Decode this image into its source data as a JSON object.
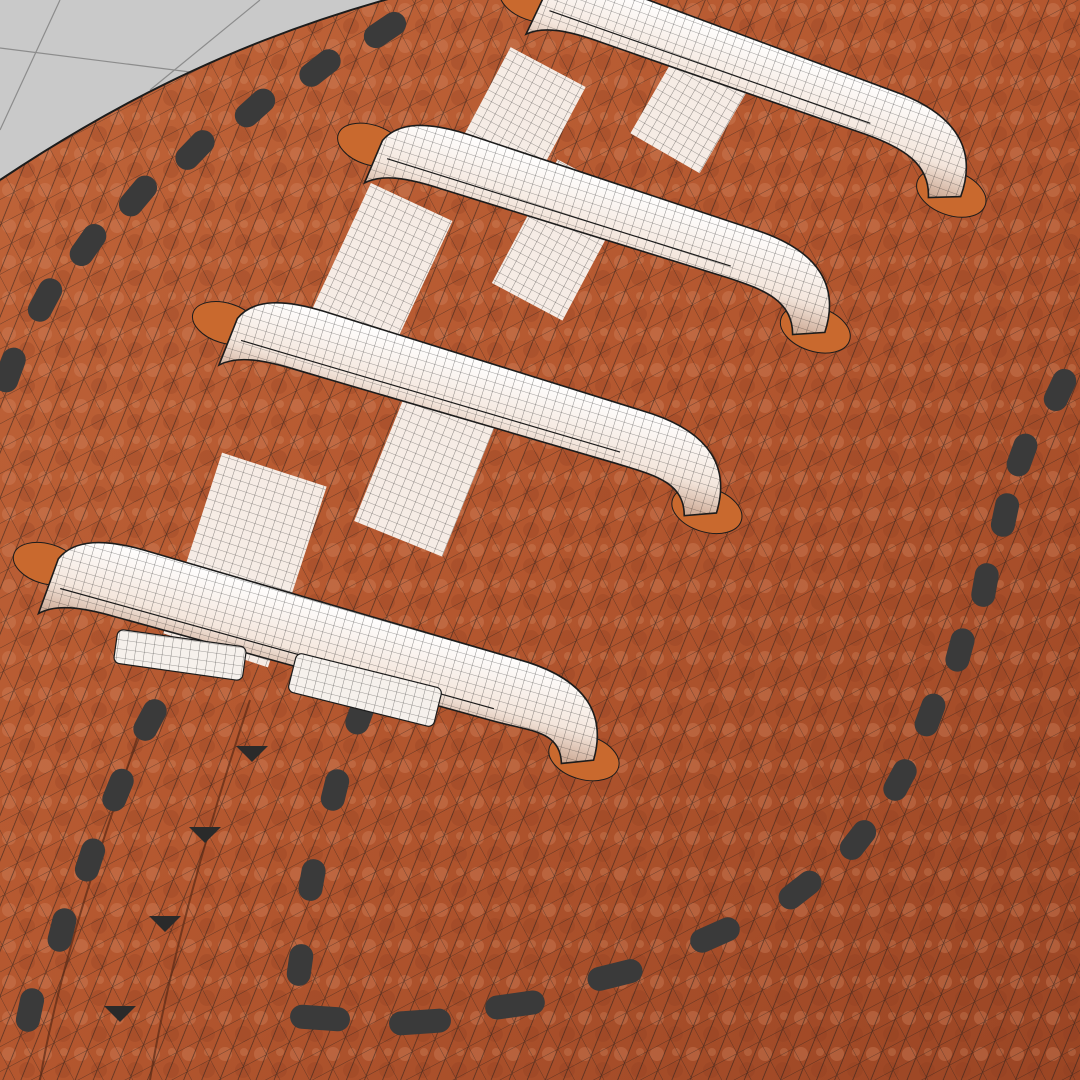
{
  "viewport": {
    "background_color": "#c9c9c9",
    "wireframe_color": "#1c1c1c"
  },
  "football": {
    "leather_color": "#b4572f",
    "leather_highlight": "#d9875d",
    "leather_shadow": "#7a3219",
    "stitch_color": "#3a3a3a",
    "lace_color": "#f4e6dc",
    "lace_shadow": "#c9a48e",
    "lace_count": 4,
    "hole_color": "#c9692e"
  }
}
